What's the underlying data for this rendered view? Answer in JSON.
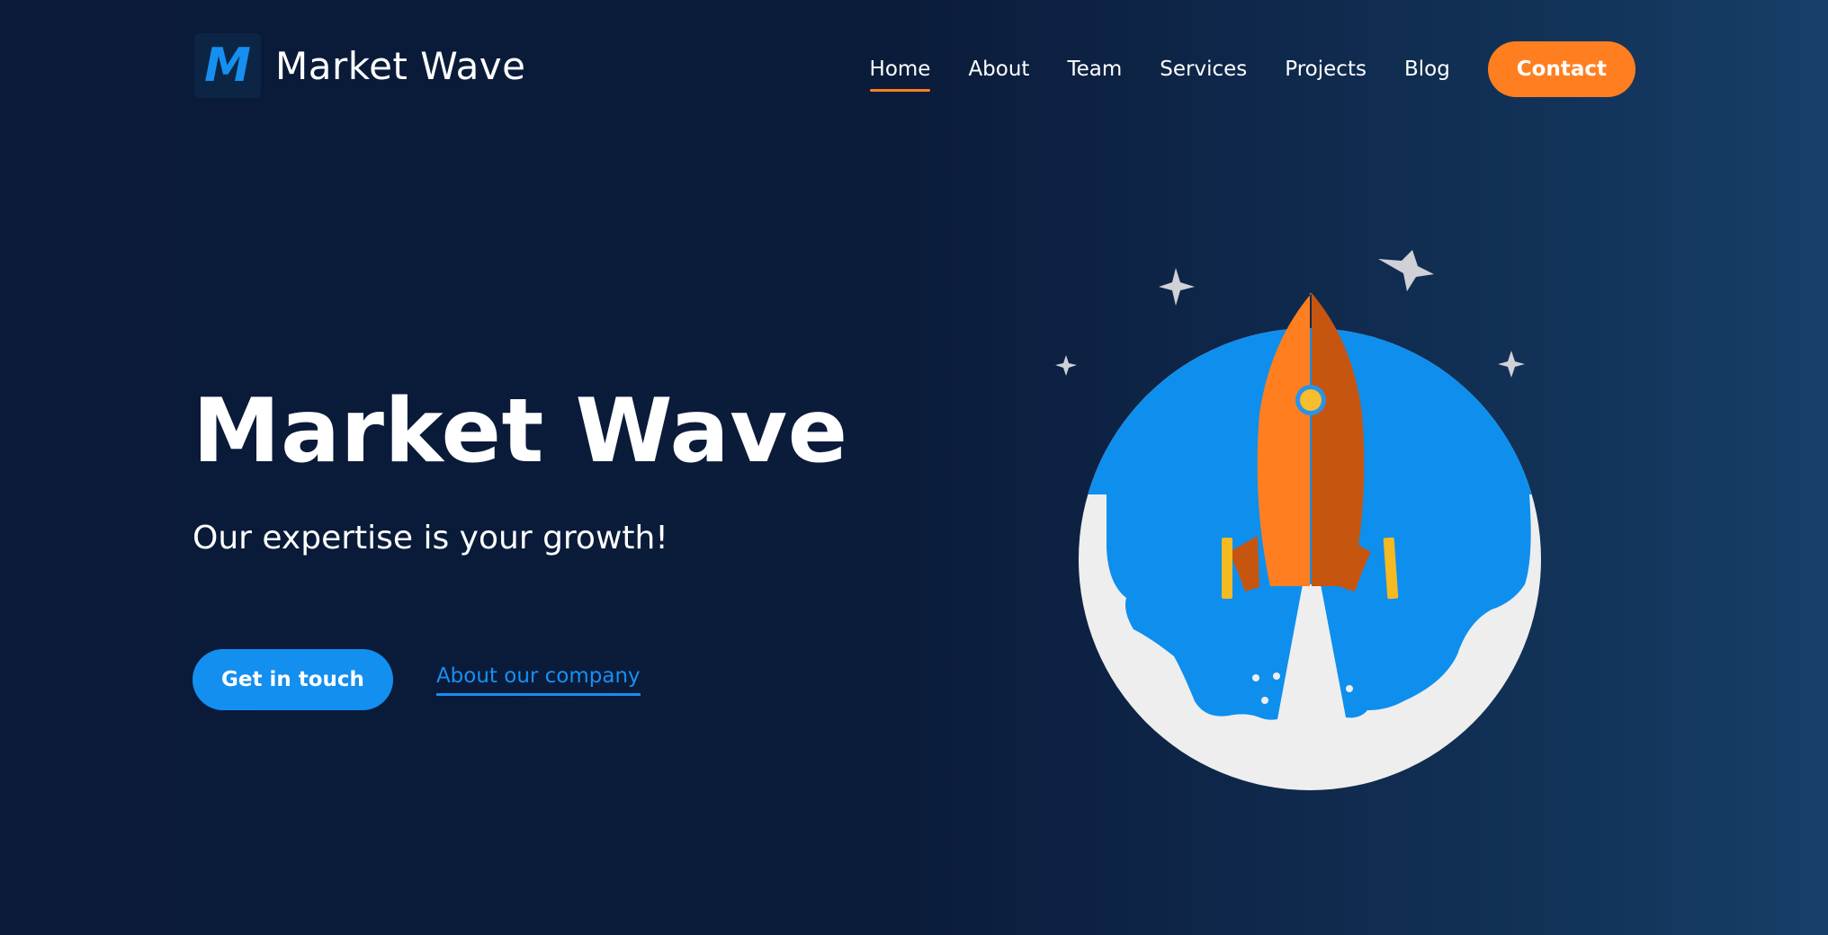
{
  "brand": {
    "logo_letter": "M",
    "name": "Market Wave",
    "accent_color": "#ff7f20",
    "primary_color": "#138ff0",
    "background_color": "#0b1c3b"
  },
  "nav": {
    "items": [
      {
        "label": "Home",
        "active": true
      },
      {
        "label": "About",
        "active": false
      },
      {
        "label": "Team",
        "active": false
      },
      {
        "label": "Services",
        "active": false
      },
      {
        "label": "Projects",
        "active": false
      },
      {
        "label": "Blog",
        "active": false
      }
    ],
    "contact_label": "Contact"
  },
  "hero": {
    "title": "Market Wave",
    "subtitle": "Our expertise is your growth!",
    "primary_cta": "Get in touch",
    "secondary_cta": "About our company"
  },
  "illustration": {
    "icons": [
      "rocket-icon",
      "planet-icon",
      "star-icon"
    ]
  }
}
